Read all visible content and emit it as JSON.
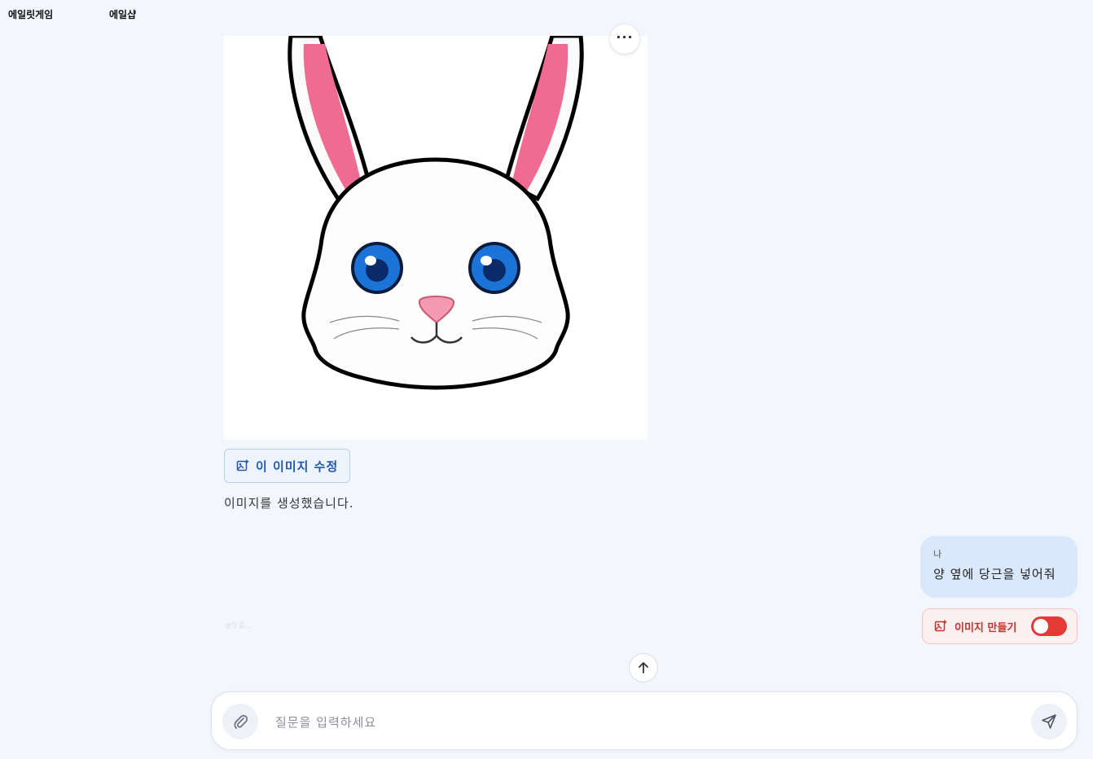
{
  "nav": {
    "game_link": "에일릿게임",
    "shop_link": "에일샵"
  },
  "assistant": {
    "image_menu_label": "···",
    "edit_image_label": "이 이미지 수정",
    "message": "이미지를 생성했습니다."
  },
  "user": {
    "name": "나",
    "message": "양 옆에 당근을 넣어줘"
  },
  "faint_text": "생각 중...",
  "image_toggle": {
    "label": "이미지 만들기",
    "enabled": true,
    "color": "#e53935"
  },
  "composer": {
    "placeholder": "질문을 입력하세요",
    "value": ""
  },
  "colors": {
    "background": "#f3f7fd",
    "accent_blue": "#2358a8",
    "user_bubble": "#dbe8fb",
    "toggle_red": "#e53935"
  }
}
